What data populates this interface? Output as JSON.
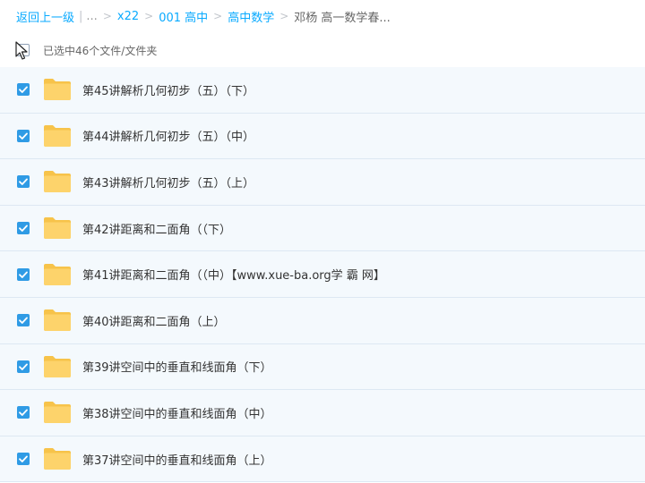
{
  "breadcrumb": {
    "back_label": "返回上一级",
    "ellipsis": "...",
    "items": [
      "x22",
      "001 高中",
      "高中数学"
    ],
    "current": "邓杨 高一数学春...",
    "separator": ">"
  },
  "selection": {
    "status_text": "已选中46个文件/文件夹"
  },
  "colors": {
    "accent": "#09aaff",
    "checkbox": "#2f9be5",
    "folder": "#fdd36b",
    "row_bg": "#f4f9fd"
  },
  "files": [
    {
      "name": "第45讲解析几何初步（五）（下）",
      "icon": "folder-icon",
      "checked": true
    },
    {
      "name": "第44讲解析几何初步（五）（中）",
      "icon": "folder-icon",
      "checked": true
    },
    {
      "name": "第43讲解析几何初步（五）（上）",
      "icon": "folder-icon",
      "checked": true
    },
    {
      "name": "第42讲距离和二面角（（下）",
      "icon": "folder-icon",
      "checked": true
    },
    {
      "name": "第41讲距离和二面角（（中）【www.xue-ba.org学 霸 网】",
      "icon": "folder-icon",
      "checked": true
    },
    {
      "name": "第40讲距离和二面角（上）",
      "icon": "folder-icon",
      "checked": true
    },
    {
      "name": "第39讲空间中的垂直和线面角（下）",
      "icon": "folder-icon",
      "checked": true
    },
    {
      "name": "第38讲空间中的垂直和线面角（中）",
      "icon": "folder-icon",
      "checked": true
    },
    {
      "name": "第37讲空间中的垂直和线面角（上）",
      "icon": "folder-icon",
      "checked": true
    }
  ]
}
